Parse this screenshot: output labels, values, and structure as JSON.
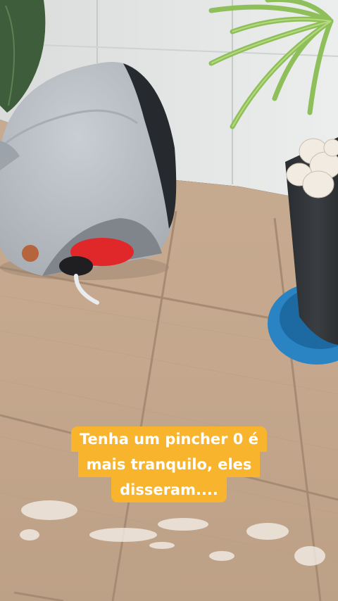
{
  "story": {
    "caption_lines": [
      "Tenha um pincher 0 é",
      "mais tranquilo, eles",
      "disseram...."
    ],
    "caption_bg": "#f7b42c",
    "caption_text_color": "#ffffff"
  },
  "scene": {
    "floor_color": "#c2a78d",
    "grout_color": "#a48a72",
    "wall_color": "#e3e6e4",
    "pet_bed_color": "#bcc2c8",
    "pet_bed_cushion_color": "#e0282a",
    "plant_pot_color": "#2f3236",
    "pot_saucer_color": "#2a84c4",
    "icons": [
      "pet-bed-icon",
      "potted-plant-icon",
      "large-leaf-icon",
      "scattered-soil-icon"
    ]
  }
}
